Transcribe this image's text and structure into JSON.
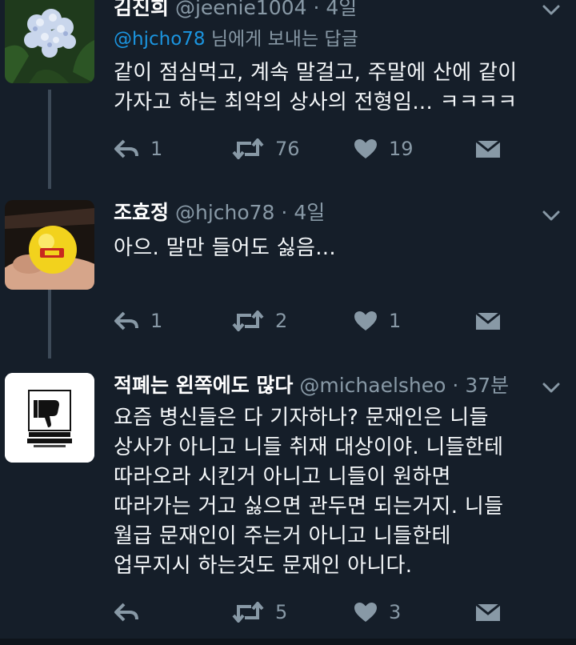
{
  "tweets": [
    {
      "name": "김진희",
      "handle": "@jeenie1004",
      "time": "· 4일",
      "reply_to_handle": "@hjcho78",
      "reply_to_suffix": " 님에게 보내는 답글",
      "lines": [
        "같이 점심먹고, 계속 말걸고, 주말에 산에 같이",
        "가자고 하는 최악의 상사의 전형임... ㅋㅋㅋㅋ"
      ],
      "replies": "1",
      "retweets": "76",
      "likes": "19",
      "avatar_icon": "hydrangea-flower-photo"
    },
    {
      "name": "조효정",
      "handle": "@hjcho78",
      "time": "· 4일",
      "lines": [
        "아으. 말만 들어도 싫음..."
      ],
      "replies": "1",
      "retweets": "2",
      "likes": "1",
      "avatar_icon": "yellow-candle-photo"
    },
    {
      "name": "적폐는 왼쪽에도 많다",
      "handle": "@michaelsheo",
      "time": "· 37분",
      "lines": [
        "요즘 병신들은 다 기자하나? 문재인은 니들",
        "상사가 아니고 니들 취재 대상이야. 니들한테",
        "따라오라 시킨거 아니고 니들이 원하면",
        "따라가는 거고 싫으면 관두면 되는거지. 니들",
        "월급 문재인이 주는거 아니고 니들한테",
        "업무지시 하는것도 문재인 아니다."
      ],
      "replies": "",
      "retweets": "5",
      "likes": "3",
      "avatar_icon": "thumbs-down-logo"
    }
  ],
  "colors": {
    "background": "#151e29",
    "muted": "#8899a6",
    "link": "#1b95e0",
    "text": "#f5f8fa"
  }
}
